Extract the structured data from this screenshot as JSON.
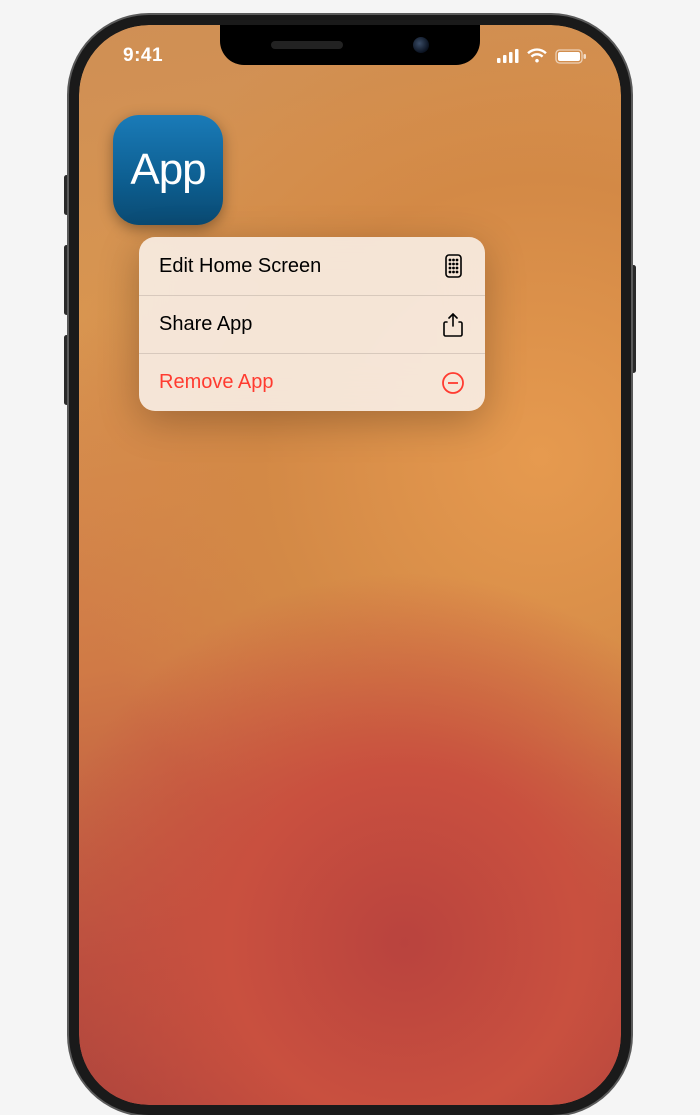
{
  "status": {
    "time": "9:41"
  },
  "app": {
    "label": "App"
  },
  "menu": {
    "edit_label": "Edit Home Screen",
    "share_label": "Share App",
    "remove_label": "Remove App"
  }
}
